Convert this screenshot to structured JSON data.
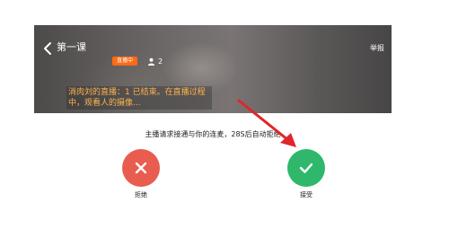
{
  "header": {
    "title": "第一课",
    "report_label": "举报",
    "live_badge": "直播中",
    "viewer_count": "2"
  },
  "notice": {
    "text": "消肉刘的直播：1 已结束。在直播过程中，观看人的摄像..."
  },
  "dialog": {
    "prompt": "主播请求接通与你的连麦，28S后自动拒绝",
    "reject_label": "拒绝",
    "accept_label": "接受"
  },
  "colors": {
    "reject": "#e85d4f",
    "accept": "#2fb86c",
    "badge": "#ff6a16",
    "notice_text": "#ffb24a",
    "annotation_arrow": "#e0262b"
  },
  "icons": {
    "back": "chevron-left-icon",
    "viewer": "person-icon",
    "reject": "close-icon",
    "accept": "check-icon"
  }
}
